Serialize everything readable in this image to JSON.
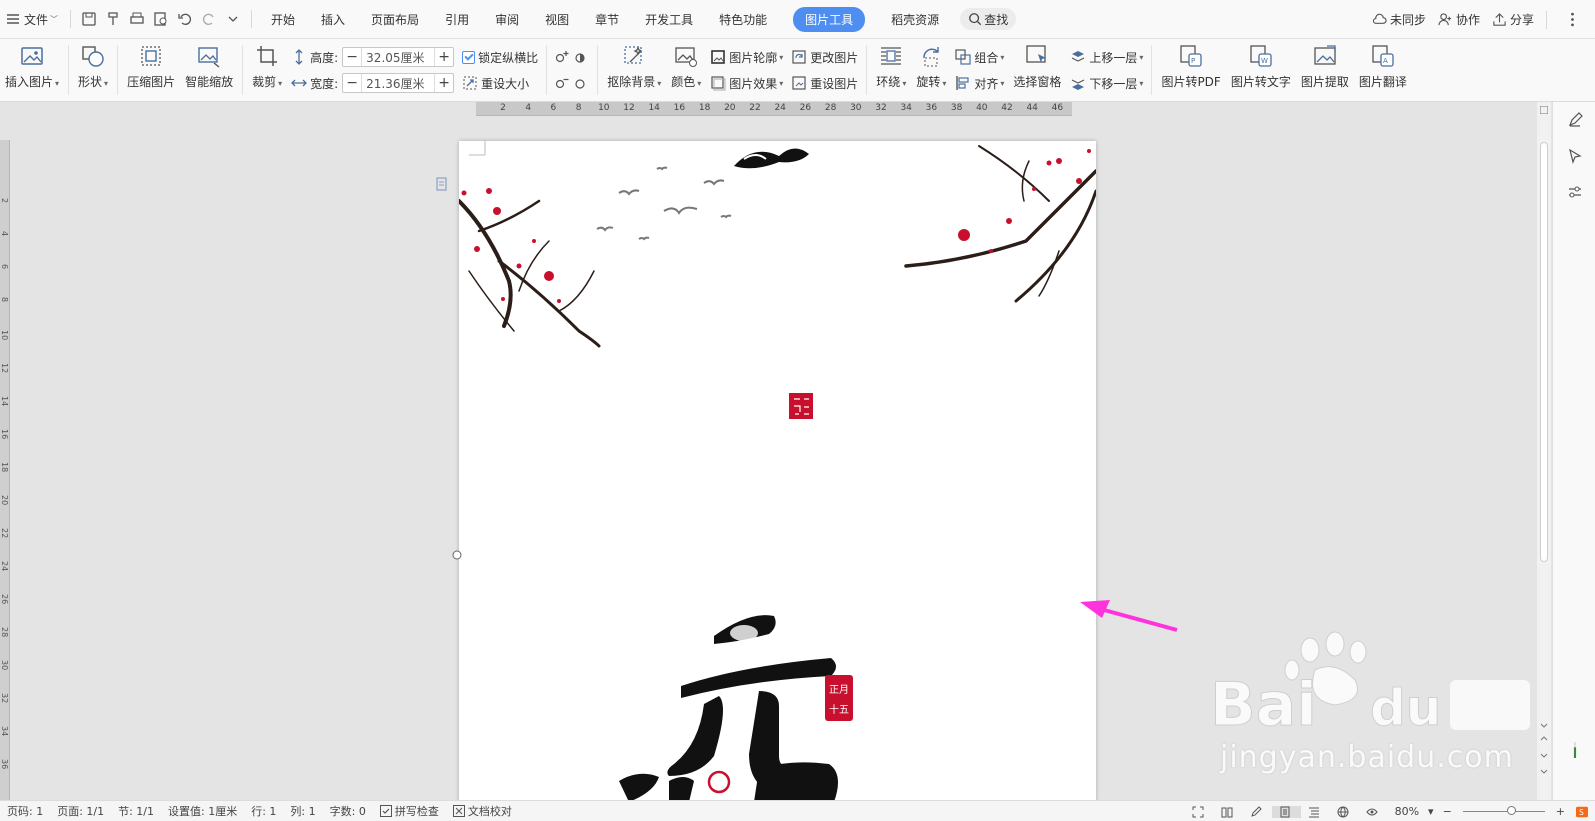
{
  "menubar": {
    "file_label": "文件",
    "tabs": [
      {
        "label": "开始"
      },
      {
        "label": "插入"
      },
      {
        "label": "页面布局"
      },
      {
        "label": "引用"
      },
      {
        "label": "审阅"
      },
      {
        "label": "视图"
      },
      {
        "label": "章节"
      },
      {
        "label": "开发工具"
      },
      {
        "label": "特色功能"
      },
      {
        "label": "图片工具",
        "active": true
      },
      {
        "label": "稻壳资源"
      }
    ],
    "search_label": "查找",
    "right": {
      "sync": "未同步",
      "collab": "协作",
      "share": "分享"
    }
  },
  "ribbon": {
    "insert_picture": "插入图片",
    "shape": "形状",
    "compress": "压缩图片",
    "smart_zoom": "智能缩放",
    "crop": "裁剪",
    "height_label": "高度:",
    "height_value": "32.05厘米",
    "width_label": "宽度:",
    "width_value": "21.36厘米",
    "lock_ratio": "锁定纵横比",
    "reset_size": "重设大小",
    "remove_bg": "抠除背景",
    "color": "颜色",
    "outline": "图片轮廓",
    "effect": "图片效果",
    "change_picture": "更改图片",
    "reset_picture": "重设图片",
    "wrap": "环绕",
    "rotate": "旋转",
    "group": "组合",
    "align": "对齐",
    "select_pane": "选择窗格",
    "bring_forward": "上移一层",
    "send_backward": "下移一层",
    "to_pdf": "图片转PDF",
    "to_text": "图片转文字",
    "extract": "图片提取",
    "translate": "图片翻译"
  },
  "ruler": {
    "ticks": [
      "2",
      "4",
      "6",
      "8",
      "10",
      "12",
      "14",
      "16",
      "18",
      "20",
      "22",
      "24",
      "26",
      "28",
      "30",
      "32",
      "34",
      "36",
      "38",
      "40",
      "42",
      "44",
      "46"
    ]
  },
  "vruler": {
    "ticks": [
      "2",
      "4",
      "6",
      "8",
      "10",
      "12",
      "14",
      "16",
      "18",
      "20",
      "22",
      "24",
      "26",
      "28",
      "30",
      "32",
      "34",
      "36"
    ]
  },
  "statusbar": {
    "page_num": "页码: 1",
    "pages": "页面: 1/1",
    "section": "节: 1/1",
    "setting": "设置值: 1厘米",
    "row": "行: 1",
    "col": "列: 1",
    "words": "字数: 0",
    "spell": "拼写检查",
    "proof": "文档校对",
    "zoom": "80%"
  },
  "watermark": {
    "text": "jingyan.baidu.com"
  },
  "colors": {
    "accent": "#4d8ef0",
    "arrow": "#ff33dd",
    "seal_red": "#c8102e"
  }
}
